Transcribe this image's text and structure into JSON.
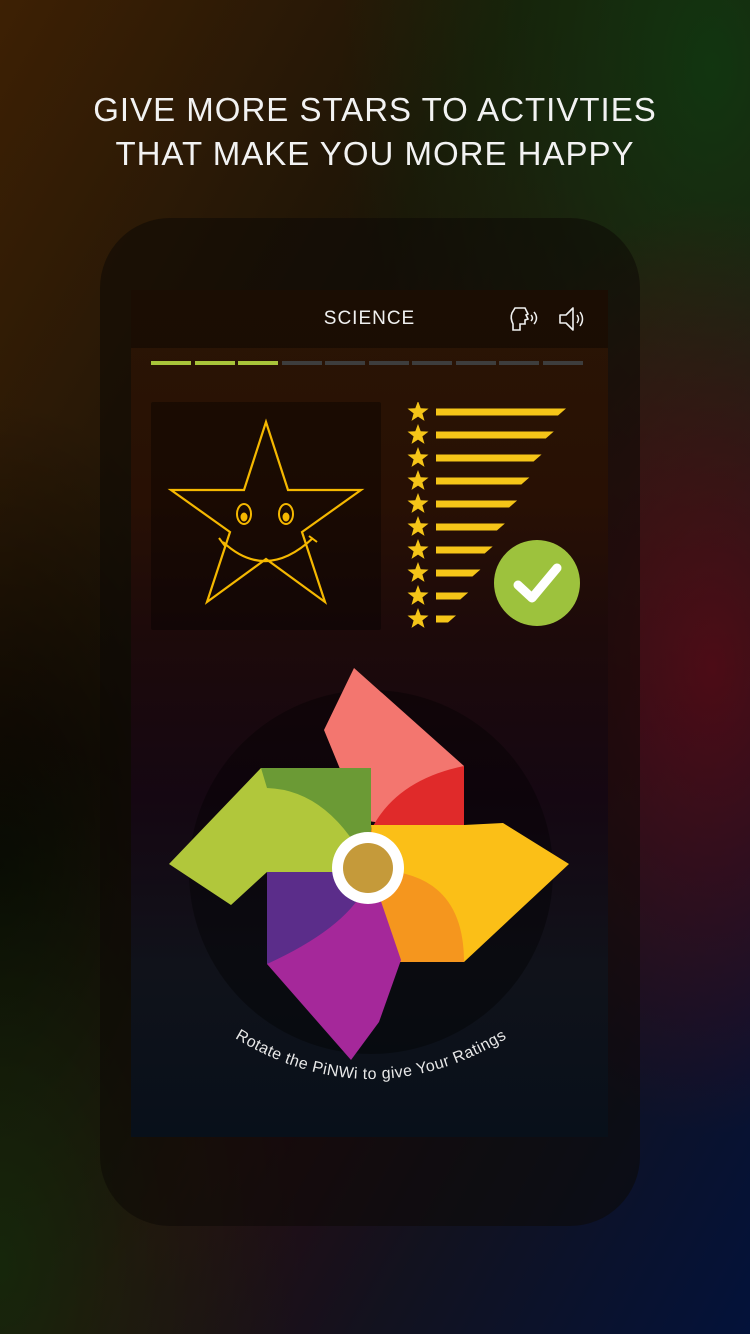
{
  "headline": {
    "line1": "GIVE MORE STARS TO ACTIVTIES",
    "line2": "THAT MAKE YOU MORE HAPPY"
  },
  "screen": {
    "title": "SCIENCE",
    "icons": {
      "speak": "speaking-head-icon",
      "sound": "speaker-icon",
      "confirm": "checkmark-icon",
      "mascot": "smiling-star-icon",
      "rating_star": "star-icon"
    },
    "progress": {
      "total_steps": 10,
      "completed_steps": 3
    },
    "rating": {
      "levels": 10,
      "selected_level": 10
    },
    "instruction": "Rotate the PiNWi to give Your Ratings"
  },
  "colors": {
    "accent_green": "#9dc23d",
    "star_yellow": "#f5c518",
    "progress_done": "#a8c43a",
    "progress_todo": "#3d3d3d",
    "petal_red": "#e02a2a",
    "petal_pink": "#f3766f",
    "petal_yellow": "#fbbf17",
    "petal_orange": "#f5961e",
    "petal_purple": "#5b2d8a",
    "petal_magenta": "#a5289a",
    "petal_green_light": "#b1c73b",
    "petal_green_dark": "#6b9a35",
    "center_gold": "#c59a3a"
  }
}
